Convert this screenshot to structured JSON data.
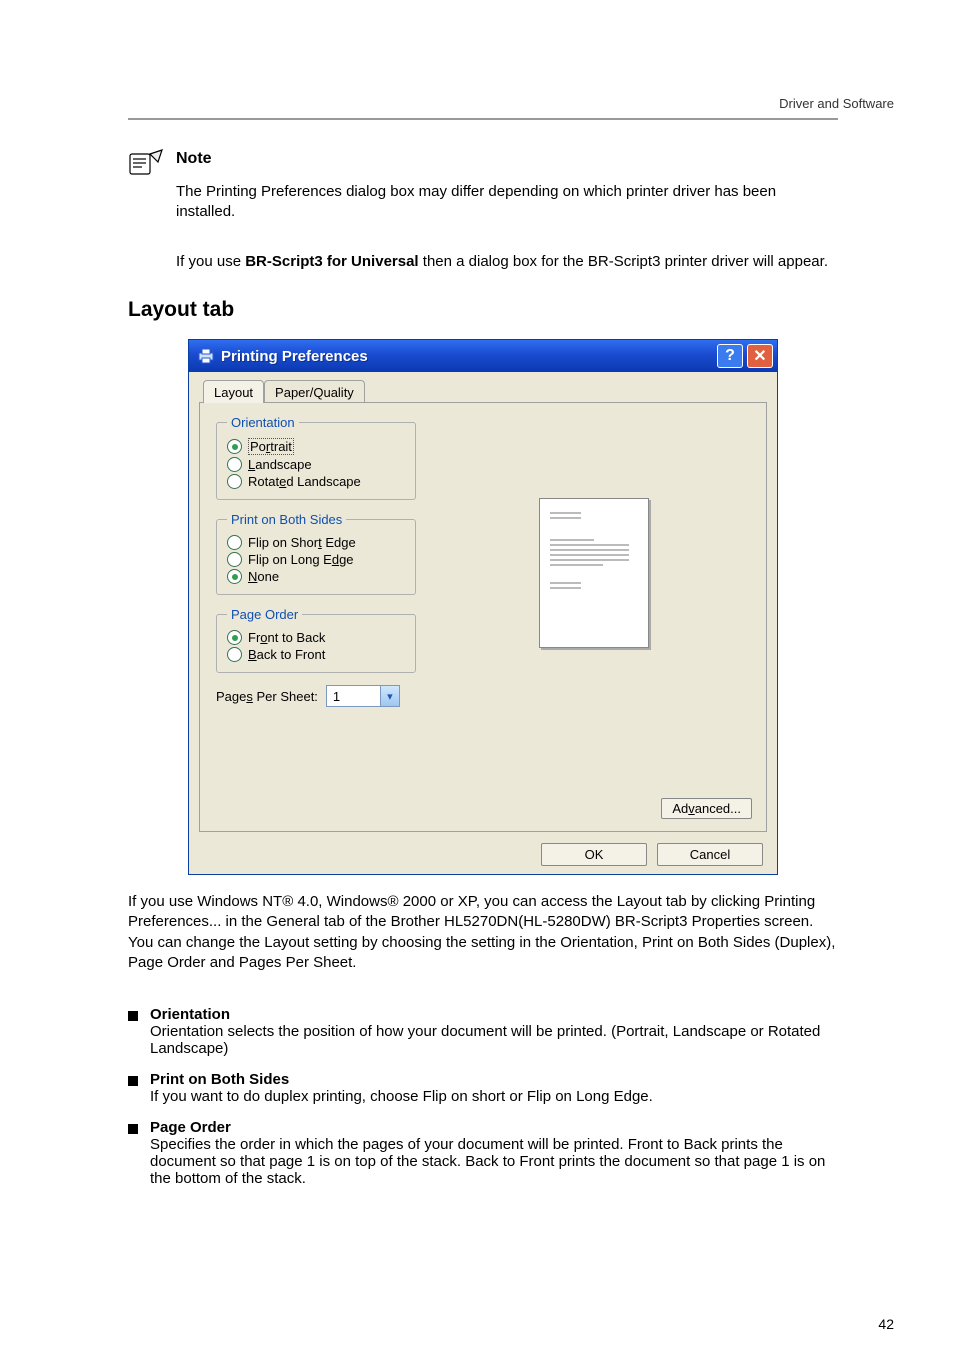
{
  "page_header_label": "Driver and Software",
  "note": {
    "heading": "Note",
    "p1": "The Printing Preferences dialog box may differ depending on which printer driver has been installed.",
    "p2_prefix": "If you use ",
    "p2_driver": "BR-Script3 for Universal",
    "p2_suffix": " then a dialog box for the BR-Script3 printer driver will appear."
  },
  "section_heading": "Layout tab",
  "dialog": {
    "title": "Printing Preferences",
    "tabs": {
      "layout": "Layout",
      "paper_quality": "Paper/Quality"
    },
    "groups": {
      "orientation": {
        "legend": "Orientation",
        "portrait_pre": "Po",
        "portrait_ul": "r",
        "portrait_post": "trait",
        "landscape_ul": "L",
        "landscape_post": "andscape",
        "rotated_pre": "Rotat",
        "rotated_ul": "e",
        "rotated_post": "d Landscape"
      },
      "both_sides": {
        "legend": "Print on Both Sides",
        "short_pre": "Flip on Shor",
        "short_ul": "t",
        "short_post": " Edge",
        "long_pre": "Flip on Long E",
        "long_ul": "d",
        "long_post": "ge",
        "none_ul": "N",
        "none_post": "one"
      },
      "page_order": {
        "legend": "Page Order",
        "ftb_pre": "Fr",
        "ftb_ul": "o",
        "ftb_post": "nt to Back",
        "btf_ul": "B",
        "btf_post": "ack to Front"
      },
      "pps": {
        "label_pre": "Page",
        "label_ul": "s",
        "label_post": " Per Sheet:",
        "value": "1"
      }
    },
    "buttons": {
      "advanced_pre": "Ad",
      "advanced_ul": "v",
      "advanced_post": "anced...",
      "ok": "OK",
      "cancel": "Cancel"
    }
  },
  "post_text": "If you use Windows NT® 4.0, Windows® 2000 or XP, you can access the Layout tab by clicking Printing Preferences... in the General tab of the Brother HL5270DN(HL-5280DW) BR-Script3 Properties screen. You can change the Layout setting by choosing the setting in the Orientation, Print on Both Sides (Duplex), Page Order and Pages Per Sheet.",
  "bullets": {
    "orientation_label": "Orientation",
    "orientation_text": "Orientation selects the position of how your document will be printed. (Portrait, Landscape or Rotated Landscape)",
    "pobs_label": "Print on Both Sides",
    "pobs_text": "If you want to do duplex printing, choose Flip on short or Flip on Long Edge.",
    "pageorder_label": "Page Order",
    "pageorder_text": "Specifies the order in which the pages of your document will be printed. Front to Back prints the document so that page 1 is on top of the stack. Back to Front prints the document so that page 1 is on the bottom of the stack."
  },
  "page_number": "42"
}
